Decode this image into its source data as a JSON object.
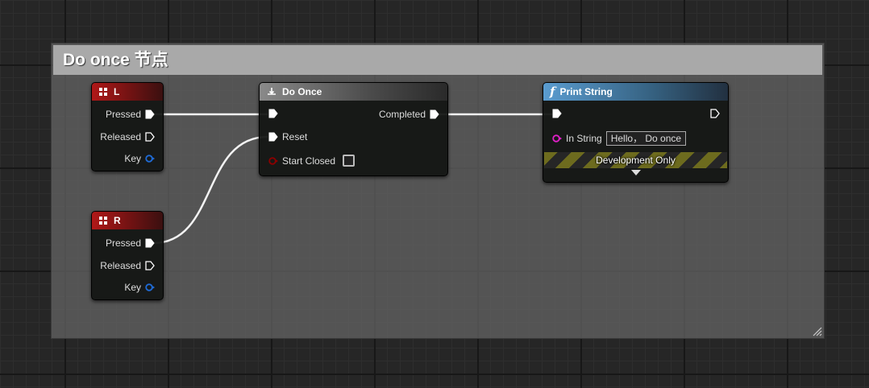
{
  "comment": {
    "title": "Do once 节点"
  },
  "key_l": {
    "title": "L",
    "pins": {
      "pressed": "Pressed",
      "released": "Released",
      "key": "Key"
    }
  },
  "key_r": {
    "title": "R",
    "pins": {
      "pressed": "Pressed",
      "released": "Released",
      "key": "Key"
    }
  },
  "do_once": {
    "title": "Do Once",
    "pins": {
      "completed": "Completed",
      "reset": "Reset",
      "start_closed": "Start Closed"
    },
    "start_closed_checked": false
  },
  "print_string": {
    "title": "Print String",
    "function_glyph": "f",
    "pins": {
      "in_string": "In String"
    },
    "in_string_value": "Hello， Do once",
    "development_only": "Development Only"
  },
  "colors": {
    "exec": "#ffffff",
    "key_pin": "#1f6bd6",
    "bool_pin": "#8c0000",
    "string_pin": "#e020c8",
    "key_header": "#b01818",
    "function_header": "#5a9cd0"
  },
  "icons": {
    "key_node": "keyboard-key-icon",
    "macro_node": "macro-icon",
    "function_node": "function-icon"
  }
}
